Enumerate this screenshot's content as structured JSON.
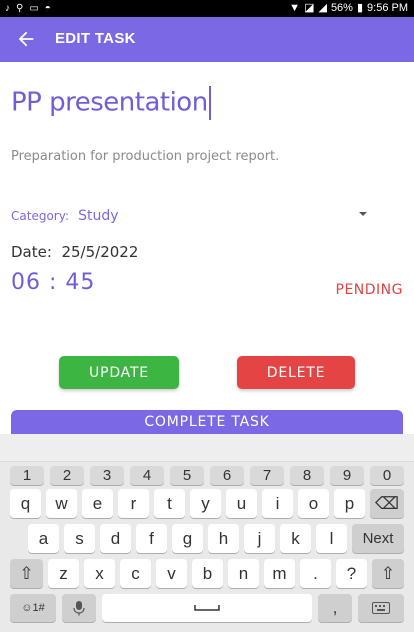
{
  "status_bar": {
    "battery": "56%",
    "time": "9:56 PM"
  },
  "app_bar": {
    "title": "EDIT TASK"
  },
  "task": {
    "title": "PP presentation",
    "description": "Preparation for production project report.",
    "category_label": "Category:",
    "category_value": "Study",
    "date_label": "Date:",
    "date_value": "25/5/2022",
    "time": "06 : 45",
    "status": "PENDING"
  },
  "buttons": {
    "update": "UPDATE",
    "delete": "DELETE",
    "complete": "COMPLETE TASK"
  },
  "keyboard": {
    "numbers": [
      "1",
      "2",
      "3",
      "4",
      "5",
      "6",
      "7",
      "8",
      "9",
      "0"
    ],
    "row1": [
      "q",
      "w",
      "e",
      "r",
      "t",
      "y",
      "u",
      "i",
      "o",
      "p"
    ],
    "row2": [
      "a",
      "s",
      "d",
      "f",
      "g",
      "h",
      "j",
      "k",
      "l"
    ],
    "row3": [
      "z",
      "x",
      "c",
      "v",
      "b",
      "n",
      "m",
      ".",
      "?"
    ],
    "next": "Next",
    "symbols": "☺1#",
    "backspace": "⌫",
    "shift": "⇧"
  }
}
